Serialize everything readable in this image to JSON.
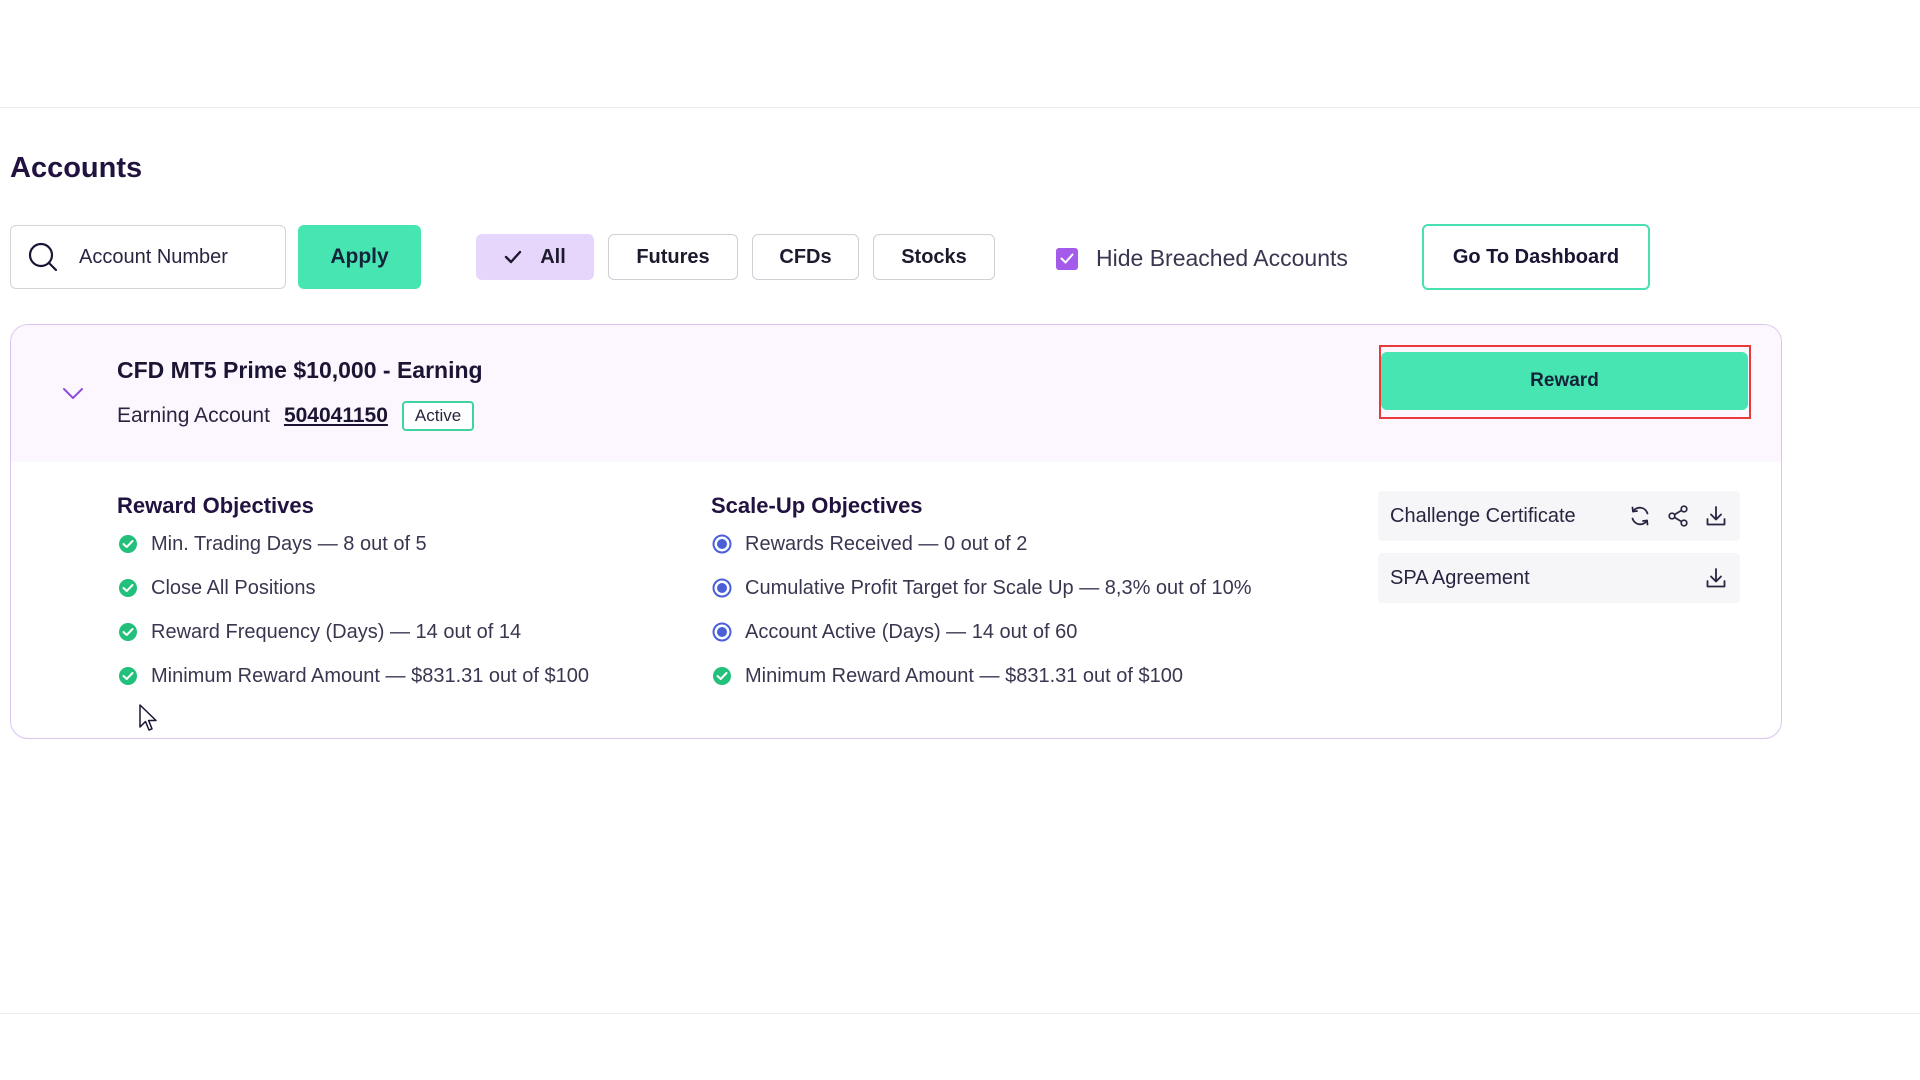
{
  "page": {
    "title": "Accounts"
  },
  "filters": {
    "search_placeholder": "Account Number",
    "apply_label": "Apply",
    "tabs": [
      {
        "label": "All",
        "active": true
      },
      {
        "label": "Futures",
        "active": false
      },
      {
        "label": "CFDs",
        "active": false
      },
      {
        "label": "Stocks",
        "active": false
      }
    ],
    "hide_breached": {
      "label": "Hide Breached Accounts",
      "checked": true
    },
    "dashboard_label": "Go To Dashboard"
  },
  "account": {
    "title": "CFD MT5 Prime $10,000 - Earning",
    "type_label": "Earning Account",
    "number": "504041150",
    "status": "Active",
    "reward_label": "Reward"
  },
  "reward_objectives": {
    "title": "Reward Objectives",
    "items": [
      {
        "text": "Min. Trading Days — 8 out of 5",
        "state": "complete"
      },
      {
        "text": "Close All Positions",
        "state": "complete"
      },
      {
        "text": "Reward Frequency (Days) — 14 out of 14",
        "state": "complete"
      },
      {
        "text": "Minimum Reward Amount — $831.31 out of $100",
        "state": "complete"
      }
    ]
  },
  "scaleup_objectives": {
    "title": "Scale-Up Objectives",
    "items": [
      {
        "text": "Rewards Received — 0 out of 2",
        "state": "in-progress"
      },
      {
        "text": "Cumulative Profit Target for Scale Up — 8,3% out of 10%",
        "state": "in-progress"
      },
      {
        "text": "Account Active (Days) — 14 out of 60",
        "state": "in-progress"
      },
      {
        "text": "Minimum Reward Amount — $831.31 out of $100",
        "state": "complete"
      }
    ]
  },
  "documents": [
    {
      "label": "Challenge Certificate",
      "icons": [
        "refresh-icon",
        "share-icon",
        "download-icon"
      ]
    },
    {
      "label": "SPA Agreement",
      "icons": [
        "download-icon"
      ]
    }
  ],
  "colors": {
    "accent_green": "#46e5b2",
    "active_tab_bg": "#e6d6fb",
    "checkbox_purple": "#a45bea",
    "complete_green": "#22c07a",
    "progress_blue": "#4a5fd8",
    "highlight_red": "#e83a3a"
  }
}
